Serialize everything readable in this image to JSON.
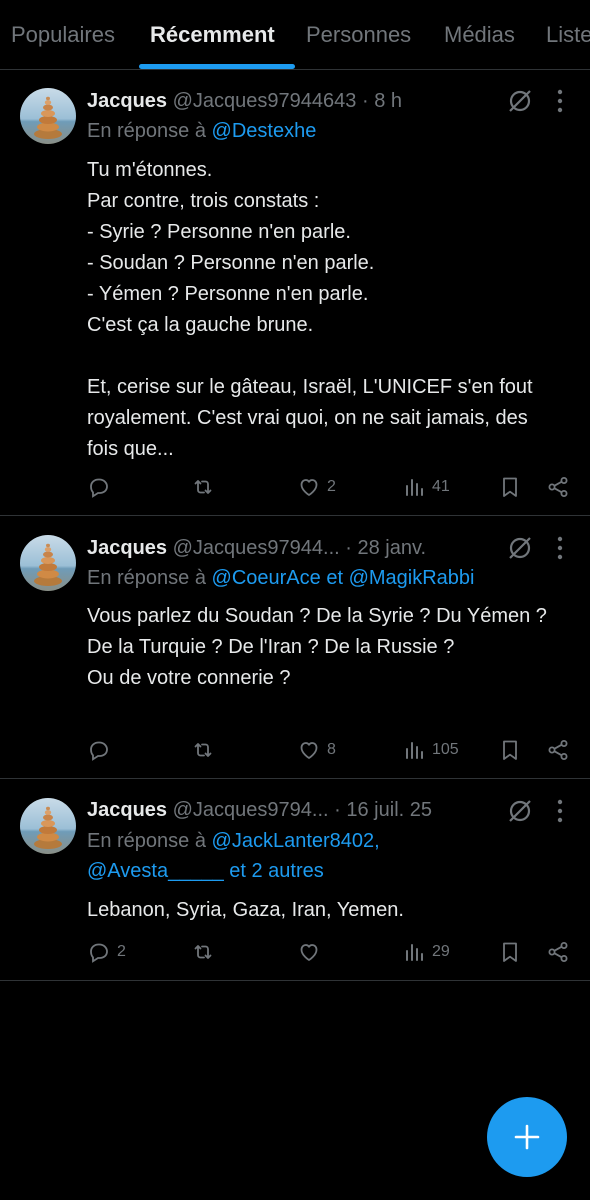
{
  "tabs": [
    "Populaires",
    "Récemment",
    "Personnes",
    "Médias",
    "Listes"
  ],
  "active_tab": "Récemment",
  "tweets": [
    {
      "author": "Jacques",
      "handle": "@Jacques97944643",
      "sep": " · ",
      "time": "8 h",
      "reply_prefix": "En réponse à ",
      "reply_mentions": "@Destexhe",
      "body": [
        "Tu m'étonnes.",
        "Par contre, trois constats :",
        "- Syrie ? Personne n'en parle.",
        "- Soudan ? Personne n'en parle.",
        "- Yémen ? Personne n'en parle.",
        "C'est ça la gauche brune.",
        "",
        "Et, cerise sur le gâteau, Israël, L'UNICEF s'en fout royalement. C'est vrai quoi, on ne sait jamais, des fois que..."
      ],
      "replies": "",
      "reposts": "",
      "likes": "2",
      "views": "41"
    },
    {
      "author": "Jacques",
      "handle": "@Jacques97944...",
      "sep": " · ",
      "time": "28 janv.",
      "reply_prefix": "En réponse à ",
      "reply_mentions": "@CoeurAce et @MagikRabbi",
      "body": [
        "Vous parlez du Soudan ? De la Syrie ? Du Yémen ?  De la Turquie ? De l'Iran ? De la Russie ?",
        "Ou de votre connerie ?"
      ],
      "replies": "",
      "reposts": "",
      "likes": "8",
      "views": "105"
    },
    {
      "author": "Jacques",
      "handle": "@Jacques9794...",
      "sep": " · ",
      "time": "16 juil. 25",
      "reply_prefix": "En réponse à ",
      "reply_mentions": "@JackLanter8402, @Avesta_____ et 2 autres",
      "body": [
        "Lebanon, Syria, Gaza, Iran, Yemen."
      ],
      "replies": "2",
      "reposts": "",
      "likes": "",
      "views": "29"
    }
  ],
  "icons": {
    "reply": "reply-icon",
    "repost": "repost-icon",
    "like": "heart-icon",
    "views": "views-icon",
    "bookmark": "bookmark-icon",
    "share": "share-icon",
    "grok": "grok-icon",
    "more": "more-icon",
    "compose": "plus-icon"
  },
  "colors": {
    "accent": "#1d9bf0",
    "background": "#000000",
    "text": "#e7e9ea",
    "muted": "#71767b",
    "divider": "#2f3336"
  }
}
